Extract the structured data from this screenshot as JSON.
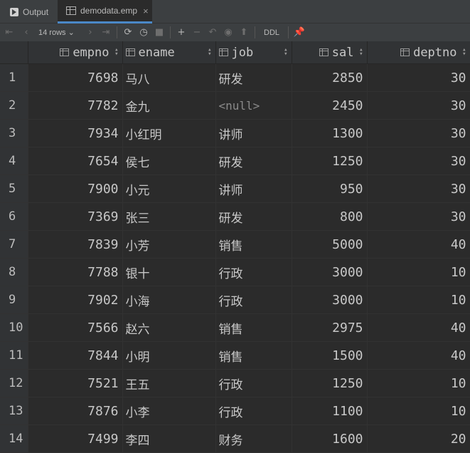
{
  "tabs": {
    "output_label": "Output",
    "active_label": "demodata.emp",
    "close_glyph": "×"
  },
  "toolbar": {
    "rows_label": "14 rows",
    "ddl_label": "DDL"
  },
  "columns": [
    "empno",
    "ename",
    "job",
    "sal",
    "deptno"
  ],
  "rows": [
    {
      "n": "1",
      "empno": "7698",
      "ename": "马八",
      "job": "研发",
      "sal": "2850",
      "deptno": "30"
    },
    {
      "n": "2",
      "empno": "7782",
      "ename": "金九",
      "job": "<null>",
      "sal": "2450",
      "deptno": "30"
    },
    {
      "n": "3",
      "empno": "7934",
      "ename": "小红明",
      "job": "讲师",
      "sal": "1300",
      "deptno": "30"
    },
    {
      "n": "4",
      "empno": "7654",
      "ename": "侯七",
      "job": "研发",
      "sal": "1250",
      "deptno": "30"
    },
    {
      "n": "5",
      "empno": "7900",
      "ename": "小元",
      "job": "讲师",
      "sal": "950",
      "deptno": "30"
    },
    {
      "n": "6",
      "empno": "7369",
      "ename": "张三",
      "job": "研发",
      "sal": "800",
      "deptno": "30"
    },
    {
      "n": "7",
      "empno": "7839",
      "ename": "小芳",
      "job": "销售",
      "sal": "5000",
      "deptno": "40"
    },
    {
      "n": "8",
      "empno": "7788",
      "ename": "银十",
      "job": "行政",
      "sal": "3000",
      "deptno": "10"
    },
    {
      "n": "9",
      "empno": "7902",
      "ename": "小海",
      "job": "行政",
      "sal": "3000",
      "deptno": "10"
    },
    {
      "n": "10",
      "empno": "7566",
      "ename": "赵六",
      "job": "销售",
      "sal": "2975",
      "deptno": "40"
    },
    {
      "n": "11",
      "empno": "7844",
      "ename": "小明",
      "job": "销售",
      "sal": "1500",
      "deptno": "40"
    },
    {
      "n": "12",
      "empno": "7521",
      "ename": "王五",
      "job": "行政",
      "sal": "1250",
      "deptno": "10"
    },
    {
      "n": "13",
      "empno": "7876",
      "ename": "小李",
      "job": "行政",
      "sal": "1100",
      "deptno": "10"
    },
    {
      "n": "14",
      "empno": "7499",
      "ename": "李四",
      "job": "财务",
      "sal": "1600",
      "deptno": "20"
    }
  ],
  "colors": {
    "background": "#2b2b2b",
    "accent": "#4a88c7",
    "null_text": "#8a8a8a"
  }
}
